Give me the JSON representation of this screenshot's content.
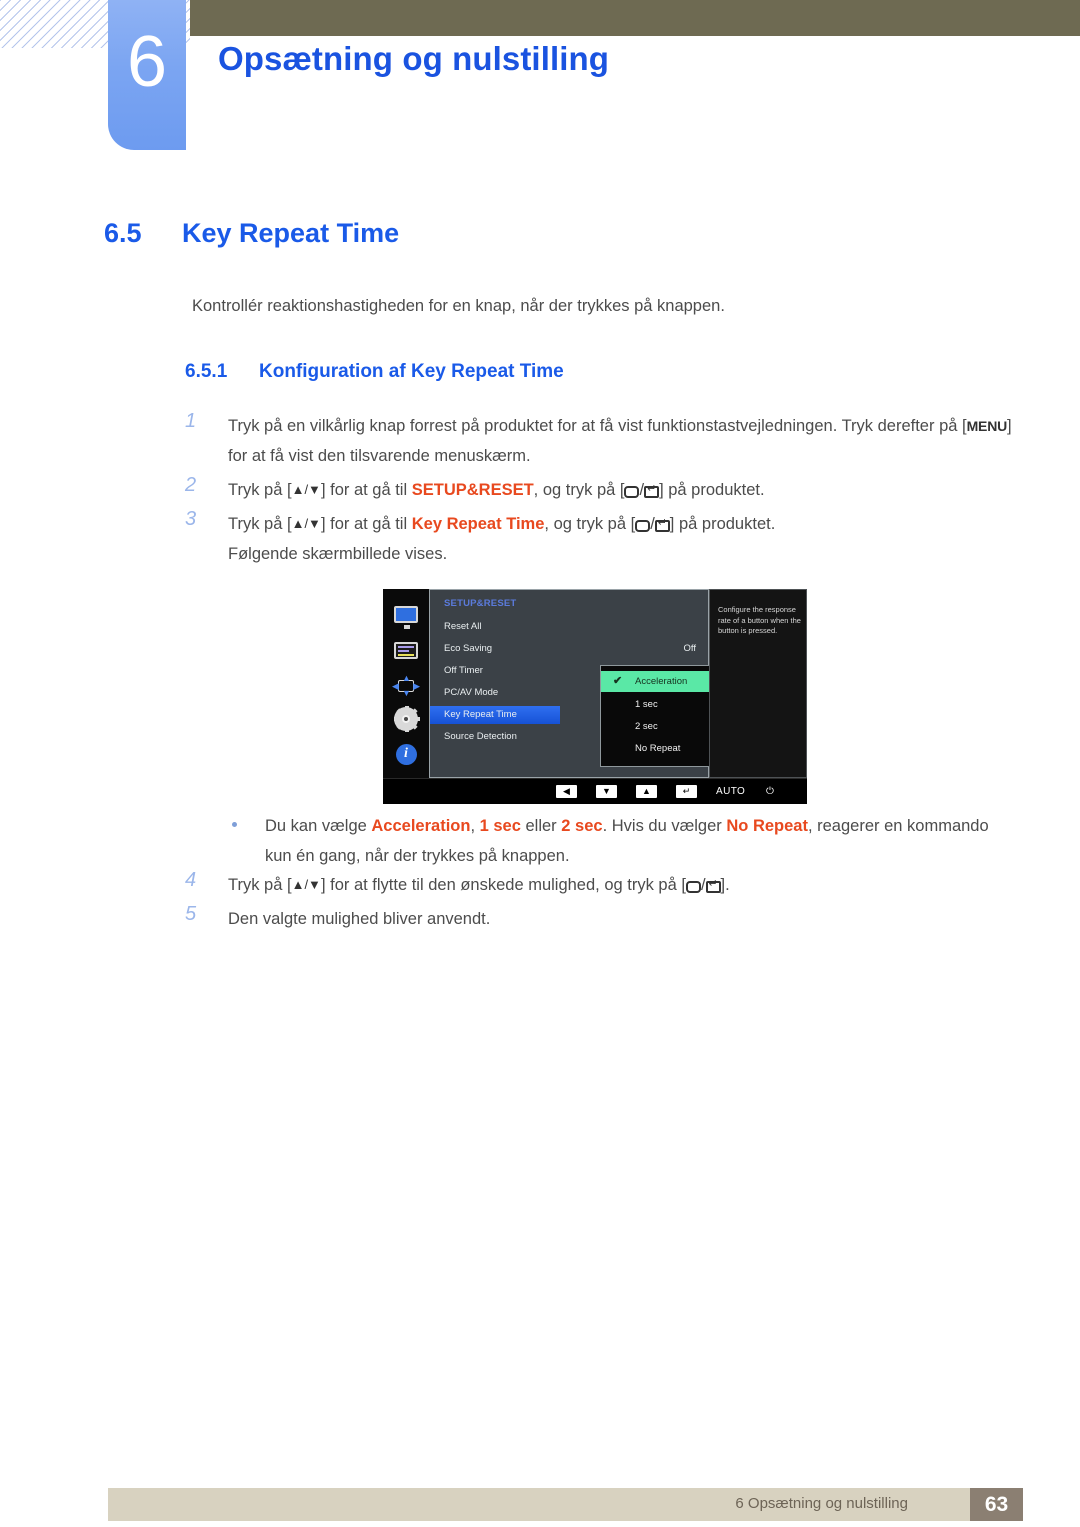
{
  "header": {
    "chapter_number": "6",
    "chapter_title": "Opsætning og nulstilling"
  },
  "section": {
    "number": "6.5",
    "title": "Key Repeat Time",
    "intro": "Kontrollér reaktionshastigheden for en knap, når der trykkes på knappen.",
    "sub_number": "6.5.1",
    "sub_title": "Konfiguration af Key Repeat Time"
  },
  "steps": [
    {
      "n": "1",
      "p1": "Tryk på en vilkårlig knap forrest på produktet for at få vist funktionstastvejledningen. Tryk derefter på [",
      "key": "MENU",
      "p2": "] for at få vist den tilsvarende menuskærm."
    },
    {
      "n": "2",
      "p1": "Tryk på [",
      "arrows": "▲/▼",
      "p2": "] for at gå til ",
      "hl": "SETUP&RESET",
      "p3": ", og tryk på [",
      "p4": "] på produktet."
    },
    {
      "n": "3",
      "p1": "Tryk på [",
      "arrows": "▲/▼",
      "p2": "] for at gå til ",
      "hl": "Key Repeat Time",
      "p3": ", og tryk på [",
      "p4": "] på produktet.",
      "note": "Følgende skærmbillede vises."
    }
  ],
  "bullet": {
    "p1": "Du kan vælge ",
    "hl1": "Acceleration",
    "p2": ", ",
    "hl2": "1 sec",
    "p3": " eller ",
    "hl3": "2 sec",
    "p4": ". Hvis du vælger ",
    "hl4": "No Repeat",
    "p5": ", reagerer en kommando kun én gang, når der trykkes på knappen."
  },
  "steps_after": [
    {
      "n": "4",
      "p1": "Tryk på [",
      "arrows": "▲/▼",
      "p2": "] for at flytte til den ønskede mulighed, og tryk på [",
      "p3": "]."
    },
    {
      "n": "5",
      "p1": "Den valgte mulighed bliver anvendt."
    }
  ],
  "osd": {
    "menu_title": "SETUP&RESET",
    "icons": [
      "monitor-icon",
      "picture-adjust-icon",
      "screen-position-icon",
      "setup-reset-gear-icon",
      "information-icon"
    ],
    "rows": [
      {
        "label": "Reset All",
        "value": ""
      },
      {
        "label": "Eco Saving",
        "value": "Off"
      },
      {
        "label": "Off Timer",
        "value": ""
      },
      {
        "label": "PC/AV Mode",
        "value": ""
      },
      {
        "label": "Key Repeat Time",
        "value": "",
        "selected": true
      },
      {
        "label": "Source Detection",
        "value": ""
      }
    ],
    "submenu": [
      {
        "label": "Acceleration",
        "checked": true
      },
      {
        "label": "1 sec",
        "checked": false
      },
      {
        "label": "2 sec",
        "checked": false
      },
      {
        "label": "No Repeat",
        "checked": false
      }
    ],
    "help_text": "Configure the response rate of a button when the button is pressed.",
    "buttons": [
      {
        "glyph": "◀",
        "name": "left-button"
      },
      {
        "glyph": "▼",
        "name": "down-button"
      },
      {
        "glyph": "▲",
        "name": "up-button"
      },
      {
        "glyph": "↵",
        "name": "enter-button"
      },
      {
        "glyph": "AUTO",
        "name": "auto-button"
      },
      {
        "glyph": "⏻",
        "name": "power-button"
      }
    ]
  },
  "footer": {
    "text": "6 Opsætning og nulstilling",
    "page": "63"
  },
  "colors": {
    "heading_blue": "#1a5ae8",
    "chapter_blue": "#1a53e0",
    "highlight_orange": "#e8491f",
    "olive": "#6e6a52",
    "footer_bg": "#d8d2c0",
    "page_box": "#8b7f72",
    "osd_select_blue": "#2f6ff0",
    "osd_select_green": "#5ae8a6"
  }
}
